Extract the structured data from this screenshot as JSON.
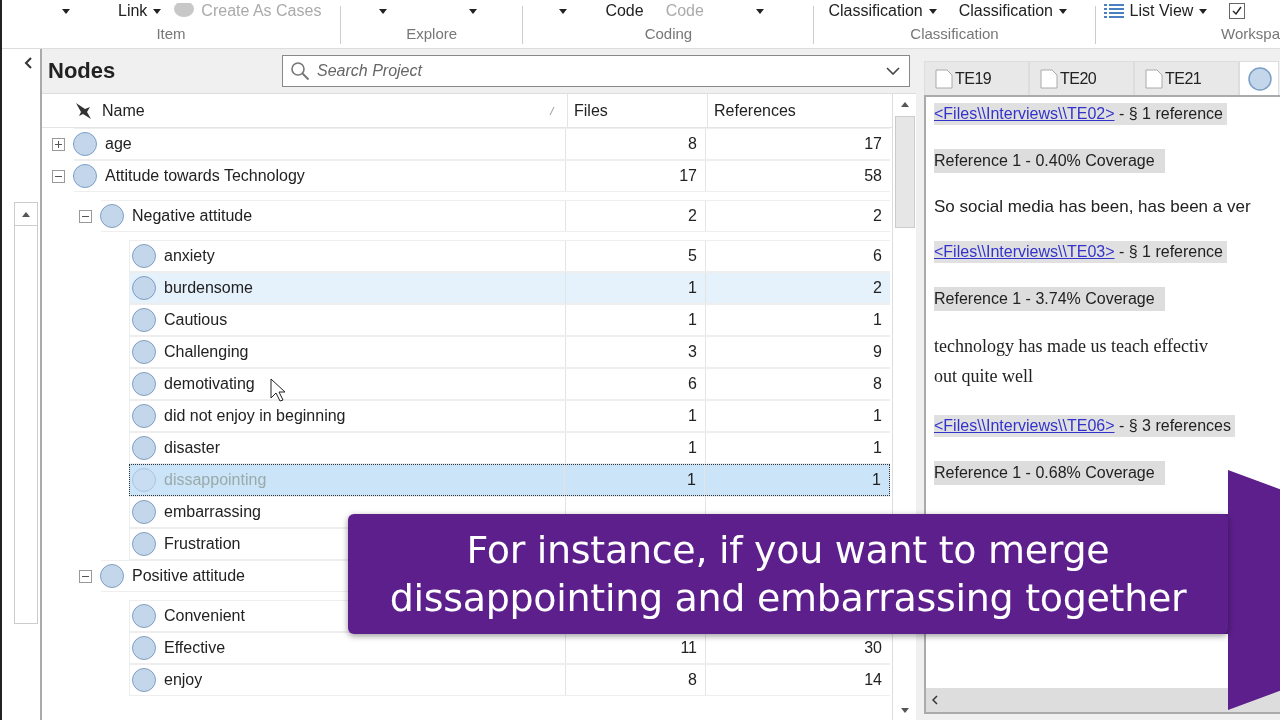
{
  "ribbon": {
    "groups": [
      {
        "label": "Item",
        "items": [
          {
            "kind": "caret"
          },
          {
            "kind": "dropdown",
            "label": "Link"
          },
          {
            "kind": "icon-button",
            "label": "Create As Cases",
            "disabled": true
          }
        ]
      },
      {
        "label": "Explore",
        "items": [
          {
            "kind": "caret"
          },
          {
            "kind": "caret"
          }
        ]
      },
      {
        "label": "Coding",
        "items": [
          {
            "kind": "caret"
          },
          {
            "kind": "button",
            "label": "Code",
            "disabled": false
          },
          {
            "kind": "button",
            "label": "Code",
            "disabled": true
          },
          {
            "kind": "caret"
          }
        ]
      },
      {
        "label": "Classification",
        "items": [
          {
            "kind": "dropdown",
            "label": "Classification"
          },
          {
            "kind": "dropdown",
            "label": "Classification"
          }
        ]
      },
      {
        "label": "Workspa",
        "items": [
          {
            "kind": "view-dropdown",
            "label": "List View"
          },
          {
            "kind": "checkbox",
            "checked": true
          }
        ]
      }
    ]
  },
  "nodes": {
    "title": "Nodes",
    "search": {
      "placeholder": "Search Project"
    },
    "columns": [
      "Name",
      "Files",
      "References"
    ],
    "rows": [
      {
        "name": "age",
        "files": "8",
        "references": "17",
        "expanded": false,
        "selected": false,
        "hovered": false
      },
      {
        "name": "Attitude towards Technology",
        "files": "17",
        "references": "58",
        "expanded": true,
        "selected": false,
        "hovered": false,
        "children": [
          {
            "name": "Negative attitude",
            "files": "2",
            "references": "2",
            "expanded": true,
            "selected": false,
            "hovered": false,
            "children": [
              {
                "name": "anxiety",
                "files": "5",
                "references": "6",
                "selected": false,
                "hovered": false
              },
              {
                "name": "burdensome",
                "files": "1",
                "references": "2",
                "selected": false,
                "hovered": true
              },
              {
                "name": "Cautious",
                "files": "1",
                "references": "1",
                "selected": false,
                "hovered": false
              },
              {
                "name": "Challenging",
                "files": "3",
                "references": "9",
                "selected": false,
                "hovered": false
              },
              {
                "name": "demotivating",
                "files": "6",
                "references": "8",
                "selected": false,
                "hovered": false
              },
              {
                "name": "did not enjoy in beginning",
                "files": "1",
                "references": "1",
                "selected": false,
                "hovered": false
              },
              {
                "name": "disaster",
                "files": "1",
                "references": "1",
                "selected": false,
                "hovered": false
              },
              {
                "name": "dissappointing",
                "files": "1",
                "references": "1",
                "selected": true,
                "hovered": false
              },
              {
                "name": "embarrassing",
                "selected": false,
                "hovered": false
              },
              {
                "name": "Frustration",
                "selected": false,
                "hovered": false
              }
            ]
          },
          {
            "name": "Positive attitude",
            "expanded": true,
            "selected": false,
            "hovered": false,
            "children": [
              {
                "name": "Convenient",
                "selected": false,
                "hovered": false
              },
              {
                "name": "Effective",
                "files": "11",
                "references": "30",
                "selected": false,
                "hovered": false
              },
              {
                "name": "enjoy",
                "files": "8",
                "references": "14",
                "selected": false,
                "hovered": false
              }
            ]
          }
        ]
      }
    ]
  },
  "detail": {
    "tabs": [
      {
        "kind": "file",
        "label": "TE19",
        "selected": false
      },
      {
        "kind": "file",
        "label": "TE20",
        "selected": false
      },
      {
        "kind": "file",
        "label": "TE21",
        "selected": false
      },
      {
        "kind": "node",
        "selected": true
      }
    ],
    "blocks": [
      {
        "kind": "source",
        "link": "<Files\\\\Interviews\\\\TE02>",
        "text": "- § 1 reference"
      },
      {
        "kind": "coverage",
        "text": "Reference 1 - 0.40% Coverage"
      },
      {
        "kind": "quote",
        "text": "So social media has been, has been a ver"
      },
      {
        "kind": "source",
        "link": "<Files\\\\Interviews\\\\TE03>",
        "text": "- § 1 reference"
      },
      {
        "kind": "coverage",
        "text": "Reference 1 - 3.74% Coverage"
      },
      {
        "kind": "doc",
        "text": "technology has made us teach effectiv\nout quite well"
      },
      {
        "kind": "source",
        "link": "<Files\\\\Interviews\\\\TE06>",
        "text": "- § 3 references"
      },
      {
        "kind": "coverage",
        "text": "Reference 1 - 0.68% Coverage"
      }
    ]
  },
  "banner": {
    "text": "For instance, if you want to merge\ndissappointing and embarrassing together"
  }
}
